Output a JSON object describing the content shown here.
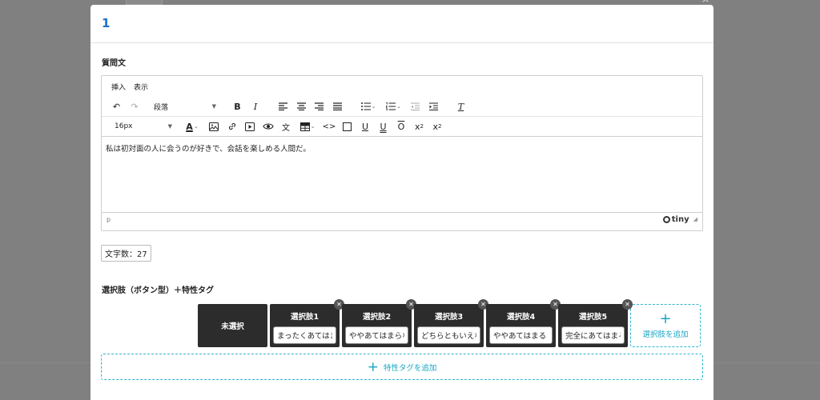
{
  "modal": {
    "title": "1"
  },
  "question": {
    "label": "質問文"
  },
  "editor": {
    "menu": [
      "挿入",
      "表示"
    ],
    "block_format": "段落",
    "font_size": "16px",
    "content": "私は初対面の人に会うのが好きで、会話を楽しめる人間だ。",
    "path": "p",
    "brand": "tiny"
  },
  "char_count": "文字数：27",
  "choices_section": {
    "label": "選択肢（ボタン型）＋特性タグ",
    "unselected_label": "未選択",
    "choices": [
      {
        "title": "選択肢1",
        "value": "まったくあてはまらない"
      },
      {
        "title": "選択肢2",
        "value": "ややあてはまらない"
      },
      {
        "title": "選択肢3",
        "value": "どちらともいえない"
      },
      {
        "title": "選択肢4",
        "value": "ややあてはまる"
      },
      {
        "title": "選択肢5",
        "value": "完全にあてはまる"
      }
    ],
    "add_choice_label": "選択肢を追加",
    "add_tag_label": "特性タグを追加"
  }
}
